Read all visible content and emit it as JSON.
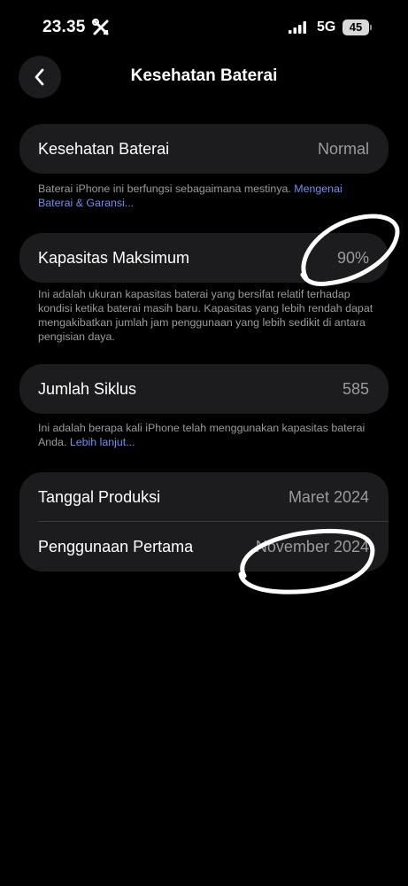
{
  "status_bar": {
    "time": "23.35",
    "network": "5G",
    "battery": "45"
  },
  "nav": {
    "title": "Kesehatan Baterai"
  },
  "health": {
    "label": "Kesehatan Baterai",
    "value": "Normal",
    "note": "Baterai iPhone ini berfungsi sebagaimana mestinya. ",
    "link": "Mengenai Baterai & Garansi..."
  },
  "capacity": {
    "label": "Kapasitas Maksimum",
    "value": "90%",
    "note": "Ini adalah ukuran kapasitas baterai yang bersifat relatif terhadap kondisi ketika baterai masih baru. Kapasitas yang lebih rendah dapat mengakibatkan jumlah jam penggunaan yang lebih sedikit di antara pengisian daya."
  },
  "cycles": {
    "label": "Jumlah Siklus",
    "value": "585",
    "note": "Ini adalah berapa kali iPhone telah menggunakan kapasitas baterai Anda. ",
    "link": "Lebih lanjut..."
  },
  "dates": {
    "manufacture_label": "Tanggal Produksi",
    "manufacture_value": "Maret 2024",
    "first_use_label": "Penggunaan Pertama",
    "first_use_value": "November 2024"
  },
  "colors": {
    "background": "#000000",
    "card": "#1c1c1e",
    "secondary_text": "#9a9a9f",
    "link": "#6d8ff7",
    "annotation": "#ffffff"
  }
}
